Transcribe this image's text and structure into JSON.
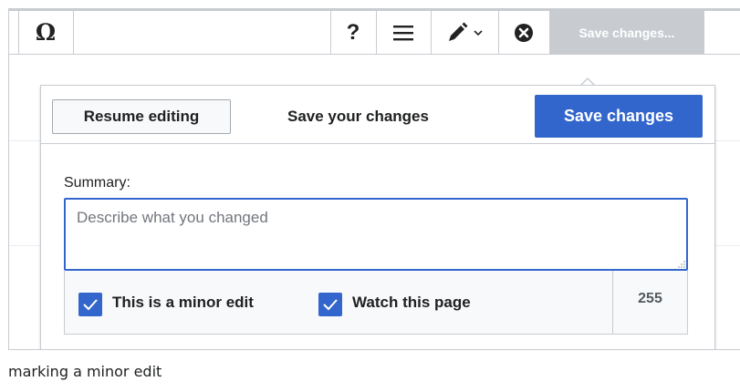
{
  "toolbar": {
    "special_char_glyph": "Ω",
    "help_glyph": "?",
    "save_changes_label": "Save changes..."
  },
  "dialog": {
    "resume_label": "Resume editing",
    "title": "Save your changes",
    "save_label": "Save changes",
    "summary_label": "Summary:",
    "summary_placeholder": "Describe what you changed",
    "summary_value": "",
    "minor_edit_label": "This is a minor edit",
    "minor_edit_checked": true,
    "watch_label": "Watch this page",
    "watch_checked": true,
    "char_counter": "255"
  },
  "caption": "marking a minor edit",
  "colors": {
    "accent": "#3366cc",
    "border": "#c8ccd1",
    "disabled_button": "#c8ccd1"
  },
  "icons": [
    "special-character-icon",
    "help-icon",
    "menu-icon",
    "edit-pencil-icon",
    "chevron-down-icon",
    "cancel-icon",
    "checkmark-icon",
    "resize-grip-icon"
  ]
}
